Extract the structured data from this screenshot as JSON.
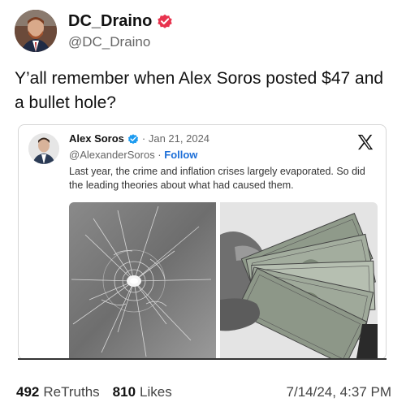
{
  "post": {
    "display_name": "DC_Draino",
    "handle": "@DC_Draino",
    "text": "Y’all remember when Alex Soros posted $47 and a bullet hole?"
  },
  "embed": {
    "display_name": "Alex Soros",
    "date": "· Jan 21, 2024",
    "handle": "@AlexanderSoros ·",
    "follow_label": "Follow",
    "text": "Last year, the crime and inflation crises largely evaporated. So did the leading theories about what had caused them."
  },
  "footer": {
    "retruths_count": "492",
    "retruths_label": "ReTruths",
    "likes_count": "810",
    "likes_label": "Likes",
    "timestamp": "7/14/24, 4:37 PM"
  },
  "colors": {
    "verified_badge": "#e8334e",
    "embed_verified": "#1d9bf0",
    "follow_link": "#1d6fd8"
  },
  "icons": {
    "verified": "verified-badge-icon",
    "x_logo": "x-logo-icon"
  }
}
